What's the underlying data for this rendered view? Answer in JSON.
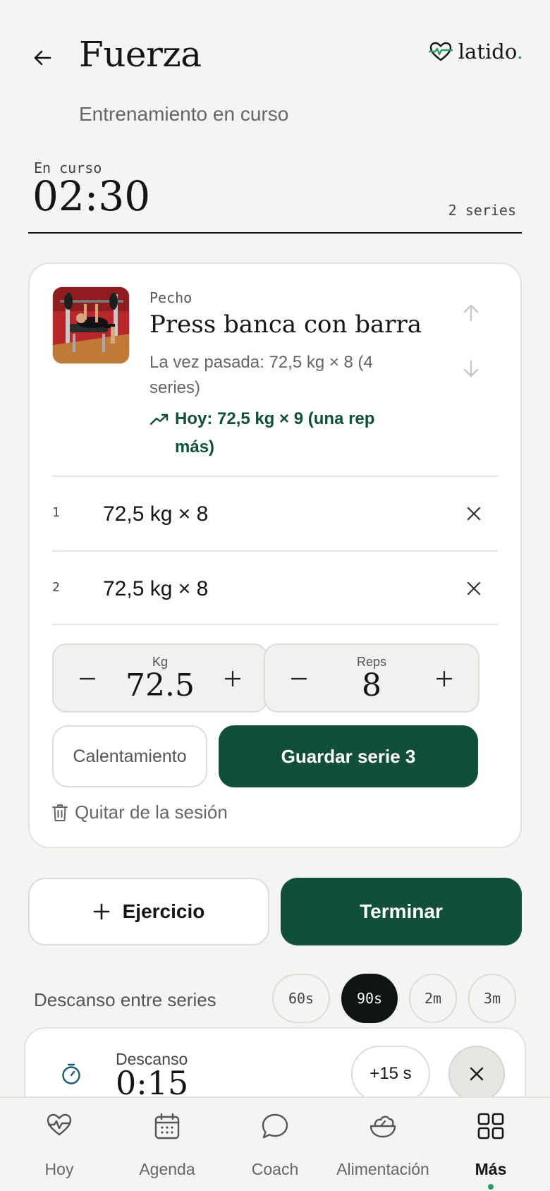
{
  "header": {
    "title": "Fuerza",
    "subtitle": "Entrenamiento en curso",
    "brand_name": "latido",
    "brand_dot": "."
  },
  "session": {
    "status_label": "En curso",
    "elapsed": "02:30",
    "series_count": "2 series"
  },
  "exercise": {
    "group": "Pecho",
    "name": "Press banca con barra",
    "last_time": "La vez pasada: 72,5 kg × 8 (4 series)",
    "today": "Hoy: 72,5 kg × 9 (una rep más)",
    "sets": [
      {
        "number": "1",
        "value": "72,5 kg × 8"
      },
      {
        "number": "2",
        "value": "72,5 kg × 8"
      }
    ],
    "weight_label": "Kg",
    "weight_value": "72.5",
    "reps_label": "Reps",
    "reps_value": "8",
    "warmup_label": "Calentamiento",
    "save_label": "Guardar serie 3",
    "remove_label": "Quitar de la sesión"
  },
  "actions": {
    "add_exercise": "Ejercicio",
    "finish": "Terminar"
  },
  "rest": {
    "label": "Descanso entre series",
    "options": [
      "60s",
      "90s",
      "2m",
      "3m"
    ],
    "selected": "90s",
    "timer_title": "Descanso",
    "timer_value": "0:15",
    "add_time": "+15 s"
  },
  "nav": {
    "items": [
      "Hoy",
      "Agenda",
      "Coach",
      "Alimentación",
      "Más"
    ],
    "active": "Más"
  },
  "colors": {
    "accent": "#114f3a",
    "brand_green": "#2a9d6a",
    "chip_active": "#0e1512",
    "background": "#f4f4f2"
  }
}
